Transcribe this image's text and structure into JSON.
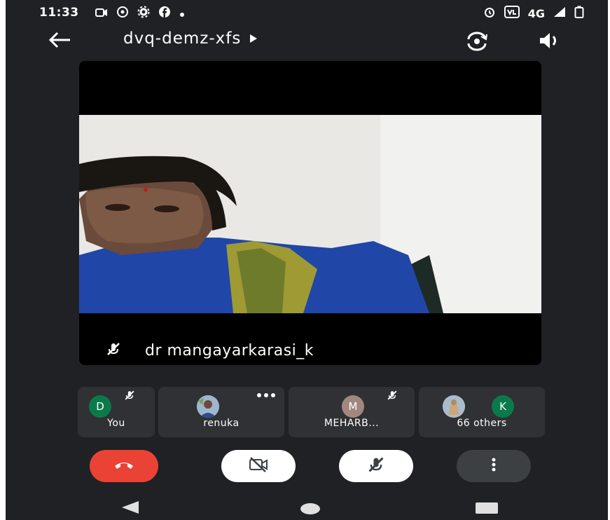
{
  "status_bar": {
    "time": "11:33",
    "network": "4G"
  },
  "meeting": {
    "code": "dvq-demz-xfs"
  },
  "main_speaker": {
    "name": "dr mangayarkarasi_k"
  },
  "participants": [
    {
      "avatar": "D",
      "label": "You",
      "avatar_color": "#0b7a4b"
    },
    {
      "label": "renuka"
    },
    {
      "avatar": "M",
      "label": "MEHARB...",
      "avatar_color": "#a1887f"
    },
    {
      "avatar": "K",
      "label": "66 others",
      "avatar_color": "#0b7a4b"
    }
  ],
  "colors": {
    "background": "#202124",
    "card": "#303134",
    "end_call": "#ea4335",
    "control_light": "#ffffff",
    "control_dark": "#3c4043"
  },
  "icons": {
    "back": "arrow-left",
    "flip": "camera-flip",
    "speaker": "speaker",
    "muted": "mic-off",
    "more": "more-horizontal",
    "end_call": "phone-hangup",
    "camera_off": "camera-off",
    "mic_off": "mic-off",
    "menu": "more-vertical"
  }
}
